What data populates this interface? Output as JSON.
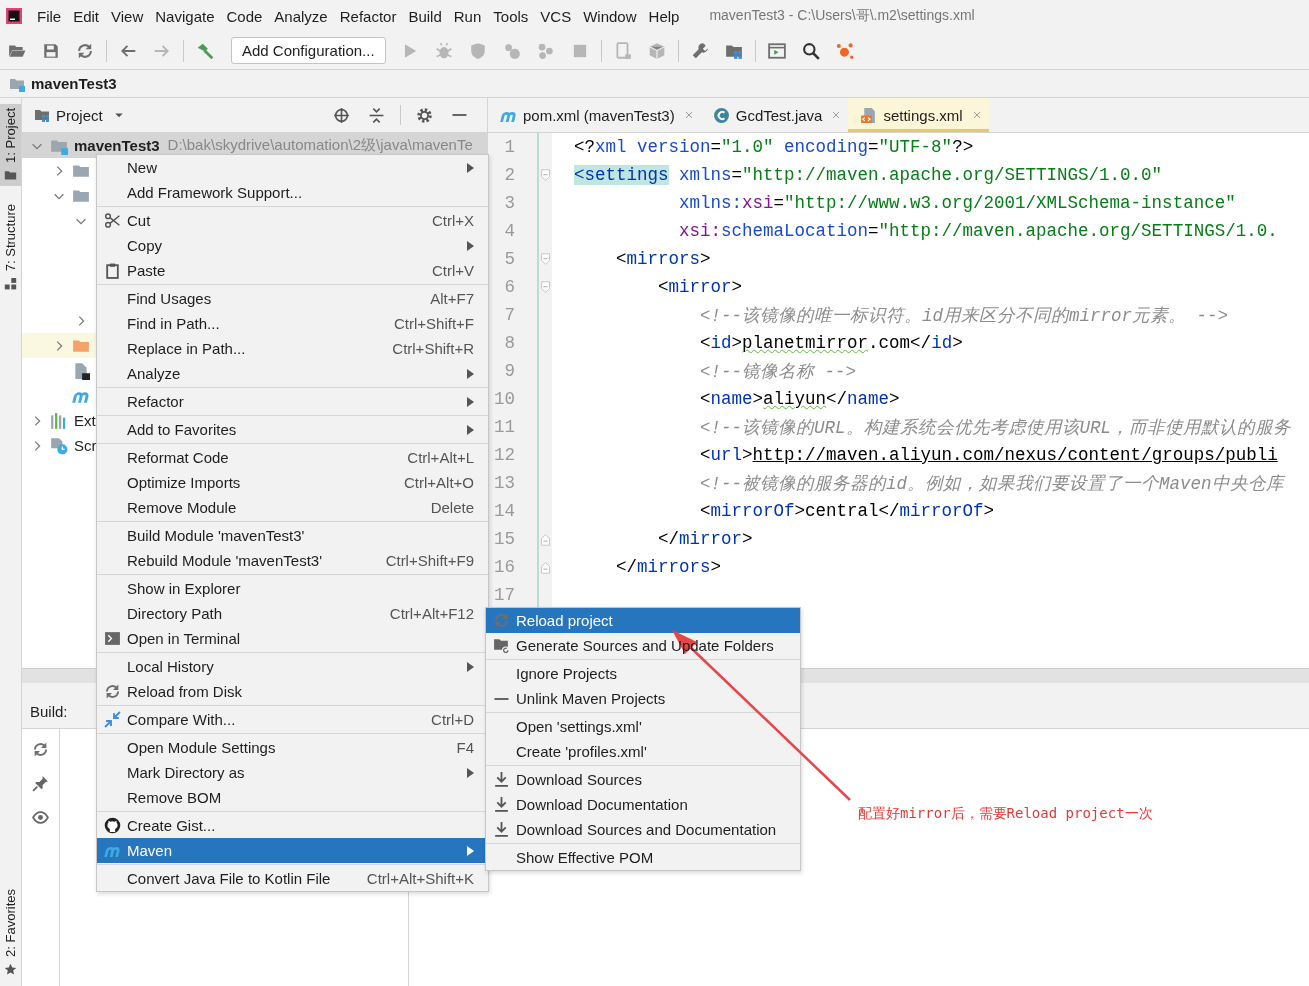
{
  "menubar": {
    "items": [
      {
        "label": "File"
      },
      {
        "label": "Edit"
      },
      {
        "label": "View"
      },
      {
        "label": "Navigate"
      },
      {
        "label": "Code"
      },
      {
        "label": "Analyze"
      },
      {
        "label": "Refactor"
      },
      {
        "label": "Build"
      },
      {
        "label": "Run"
      },
      {
        "label": "Tools"
      },
      {
        "label": "VCS"
      },
      {
        "label": "Window"
      },
      {
        "label": "Help"
      }
    ],
    "title": "mavenTest3 - C:\\Users\\哥\\.m2\\settings.xml"
  },
  "toolbar": [
    {
      "kind": "icon",
      "disabled": false
    },
    {
      "kind": "icon",
      "disabled": false
    },
    {
      "kind": "icon",
      "disabled": false
    },
    {
      "kind": "separator"
    },
    {
      "kind": "icon",
      "disabled": false
    },
    {
      "kind": "icon",
      "disabled": true
    },
    {
      "kind": "separator"
    },
    {
      "kind": "icon",
      "disabled": false
    },
    {
      "kind": "button",
      "label": "Add Configuration..."
    },
    {
      "kind": "icon",
      "disabled": true
    },
    {
      "kind": "icon",
      "disabled": true
    },
    {
      "kind": "icon",
      "disabled": true
    },
    {
      "kind": "icon",
      "disabled": true
    },
    {
      "kind": "icon",
      "disabled": true
    },
    {
      "kind": "icon",
      "disabled": true
    },
    {
      "kind": "separator"
    },
    {
      "kind": "icon",
      "disabled": true
    },
    {
      "kind": "icon",
      "disabled": true
    },
    {
      "kind": "separator"
    },
    {
      "kind": "icon",
      "disabled": false
    },
    {
      "kind": "icon",
      "disabled": false
    },
    {
      "kind": "separator"
    },
    {
      "kind": "icon",
      "disabled": false
    },
    {
      "kind": "icon",
      "disabled": false
    },
    {
      "kind": "icon",
      "disabled": false
    }
  ],
  "breadcrumb": {
    "label": "mavenTest3"
  },
  "left_stripe": [
    {
      "label": "1: Project",
      "selected": true
    },
    {
      "label": "7: Structure",
      "selected": false
    },
    {
      "label": "2: Favorites",
      "selected": false
    }
  ],
  "project_panel": {
    "title": "Project",
    "tree": [
      {
        "label": "mavenTest3",
        "detail": "D:\\bak\\skydrive\\automation\\2级\\java\\mavenTe",
        "expanded": true,
        "selected": true,
        "highlighted": false,
        "children": [
          {
            "expanded": false,
            "selected": false,
            "highlighted": false
          },
          {
            "expanded": true,
            "selected": false,
            "highlighted": false,
            "children": [
              {
                "expanded": true,
                "selected": false,
                "highlighted": false
              },
              {
                "expanded": false,
                "selected": false,
                "highlighted": false
              }
            ]
          },
          {
            "expanded": false,
            "selected": false,
            "highlighted": true
          },
          {
            "selected": false,
            "highlighted": false
          },
          {
            "selected": false,
            "highlighted": false
          }
        ]
      },
      {
        "label": "Ext",
        "expanded": false,
        "selected": false,
        "highlighted": false
      },
      {
        "label": "Scr",
        "expanded": false,
        "selected": false,
        "highlighted": false
      }
    ]
  },
  "editor_tabs": [
    {
      "label": "pom.xml (mavenTest3)",
      "selected": false
    },
    {
      "label": "GcdTest.java",
      "selected": false
    },
    {
      "label": "settings.xml",
      "selected": true
    }
  ],
  "editor_lines": [
    {
      "number": "1",
      "tokens": [
        {
          "kind": "punct",
          "text": "<?"
        },
        {
          "kind": "attr",
          "text": "xml version"
        },
        {
          "kind": "punct",
          "text": "="
        },
        {
          "kind": "value",
          "text": "\"1.0\""
        },
        {
          "kind": "attr",
          "text": " encoding"
        },
        {
          "kind": "punct",
          "text": "="
        },
        {
          "kind": "value",
          "text": "\"UTF-8\""
        },
        {
          "kind": "punct",
          "text": "?>"
        }
      ]
    },
    {
      "number": "2",
      "tokens": [
        {
          "kind": "matched",
          "text": "<settings"
        },
        {
          "kind": "attr",
          "text": " xmlns"
        },
        {
          "kind": "punct",
          "text": "="
        },
        {
          "kind": "value",
          "text": "\"http://maven.apache.org/SETTINGS/1.0.0\""
        }
      ]
    },
    {
      "number": "3",
      "tokens": [
        {
          "kind": "attr",
          "text": "          xmlns:"
        },
        {
          "kind": "ns",
          "text": "xsi"
        },
        {
          "kind": "punct",
          "text": "="
        },
        {
          "kind": "value",
          "text": "\"http://www.w3.org/2001/XMLSchema-instance\""
        }
      ]
    },
    {
      "number": "4",
      "tokens": [
        {
          "kind": "ns",
          "text": "          xsi:"
        },
        {
          "kind": "attr",
          "text": "schemaLocation"
        },
        {
          "kind": "punct",
          "text": "="
        },
        {
          "kind": "value",
          "text": "\"http://maven.apache.org/SETTINGS/1.0."
        }
      ]
    },
    {
      "number": "5",
      "tokens": [
        {
          "kind": "punct",
          "text": "    <"
        },
        {
          "kind": "tag",
          "text": "mirrors"
        },
        {
          "kind": "punct",
          "text": ">"
        }
      ]
    },
    {
      "number": "6",
      "tokens": [
        {
          "kind": "punct",
          "text": "        <"
        },
        {
          "kind": "tag",
          "text": "mirror"
        },
        {
          "kind": "punct",
          "text": ">"
        }
      ]
    },
    {
      "number": "7",
      "tokens": [
        {
          "kind": "comment",
          "text": "            <!--该镜像的唯一标识符。id用来区分不同的mirror元素。 -->"
        }
      ]
    },
    {
      "number": "8",
      "tokens": [
        {
          "kind": "punct",
          "text": "            <"
        },
        {
          "kind": "tag",
          "text": "id"
        },
        {
          "kind": "punct",
          "text": ">"
        },
        {
          "kind": "typo",
          "text": "planetmirror"
        },
        {
          "kind": "text",
          "text": ".com"
        },
        {
          "kind": "punct",
          "text": "</"
        },
        {
          "kind": "tag",
          "text": "id"
        },
        {
          "kind": "punct",
          "text": ">"
        }
      ]
    },
    {
      "number": "9",
      "tokens": [
        {
          "kind": "comment",
          "text": "            <!--镜像名称 -->"
        }
      ]
    },
    {
      "number": "10",
      "tokens": [
        {
          "kind": "punct",
          "text": "            <"
        },
        {
          "kind": "tag",
          "text": "name"
        },
        {
          "kind": "punct",
          "text": ">"
        },
        {
          "kind": "typo",
          "text": "aliyun"
        },
        {
          "kind": "punct",
          "text": "</"
        },
        {
          "kind": "tag",
          "text": "name"
        },
        {
          "kind": "punct",
          "text": ">"
        }
      ]
    },
    {
      "number": "11",
      "tokens": [
        {
          "kind": "comment",
          "text": "            <!--该镜像的URL。构建系统会优先考虑使用该URL，而非使用默认的服务"
        }
      ]
    },
    {
      "number": "12",
      "tokens": [
        {
          "kind": "punct",
          "text": "            <"
        },
        {
          "kind": "tag",
          "text": "url"
        },
        {
          "kind": "punct",
          "text": ">"
        },
        {
          "kind": "link",
          "text": "http://maven.aliyun.com/nexus/content/groups/publi"
        }
      ]
    },
    {
      "number": "13",
      "tokens": [
        {
          "kind": "comment",
          "text": "            <!--被镜像的服务器的id。例如，如果我们要设置了一个Maven中央仓库"
        }
      ]
    },
    {
      "number": "14",
      "tokens": [
        {
          "kind": "punct",
          "text": "            <"
        },
        {
          "kind": "tag",
          "text": "mirrorOf"
        },
        {
          "kind": "punct",
          "text": ">"
        },
        {
          "kind": "text",
          "text": "central"
        },
        {
          "kind": "punct",
          "text": "</"
        },
        {
          "kind": "tag",
          "text": "mirrorOf"
        },
        {
          "kind": "punct",
          "text": ">"
        }
      ]
    },
    {
      "number": "15",
      "tokens": [
        {
          "kind": "punct",
          "text": "        </"
        },
        {
          "kind": "tag",
          "text": "mirror"
        },
        {
          "kind": "punct",
          "text": ">"
        }
      ]
    },
    {
      "number": "16",
      "tokens": [
        {
          "kind": "punct",
          "text": "    </"
        },
        {
          "kind": "tag",
          "text": "mirrors"
        },
        {
          "kind": "punct",
          "text": ">"
        }
      ]
    },
    {
      "number": "17"
    }
  ],
  "build_panel": {
    "label": "Build:"
  },
  "context_menu": [
    {
      "label": "New",
      "submenu": true,
      "selected": false
    },
    {
      "label": "Add Framework Support...",
      "selected": false
    },
    {
      "label": "Cut",
      "shortcut": "Ctrl+X",
      "separator_before": true,
      "selected": false
    },
    {
      "label": "Copy",
      "submenu": true,
      "selected": false
    },
    {
      "label": "Paste",
      "shortcut": "Ctrl+V",
      "selected": false
    },
    {
      "label": "Find Usages",
      "shortcut": "Alt+F7",
      "separator_before": true,
      "selected": false
    },
    {
      "label": "Find in Path...",
      "shortcut": "Ctrl+Shift+F",
      "selected": false
    },
    {
      "label": "Replace in Path...",
      "shortcut": "Ctrl+Shift+R",
      "selected": false
    },
    {
      "label": "Analyze",
      "submenu": true,
      "selected": false
    },
    {
      "label": "Refactor",
      "submenu": true,
      "separator_before": true,
      "selected": false
    },
    {
      "label": "Add to Favorites",
      "submenu": true,
      "separator_before": true,
      "selected": false
    },
    {
      "label": "Reformat Code",
      "shortcut": "Ctrl+Alt+L",
      "separator_before": true,
      "selected": false
    },
    {
      "label": "Optimize Imports",
      "shortcut": "Ctrl+Alt+O",
      "selected": false
    },
    {
      "label": "Remove Module",
      "shortcut": "Delete",
      "selected": false
    },
    {
      "label": "Build Module 'mavenTest3'",
      "separator_before": true,
      "selected": false
    },
    {
      "label": "Rebuild Module 'mavenTest3'",
      "shortcut": "Ctrl+Shift+F9",
      "selected": false
    },
    {
      "label": "Show in Explorer",
      "separator_before": true,
      "selected": false
    },
    {
      "label": "Directory Path",
      "shortcut": "Ctrl+Alt+F12",
      "selected": false
    },
    {
      "label": "Open in Terminal",
      "selected": false
    },
    {
      "label": "Local History",
      "submenu": true,
      "separator_before": true,
      "selected": false
    },
    {
      "label": "Reload from Disk",
      "selected": false
    },
    {
      "label": "Compare With...",
      "shortcut": "Ctrl+D",
      "separator_before": true,
      "selected": false
    },
    {
      "label": "Open Module Settings",
      "shortcut": "F4",
      "separator_before": true,
      "selected": false
    },
    {
      "label": "Mark Directory as",
      "submenu": true,
      "selected": false
    },
    {
      "label": "Remove BOM",
      "selected": false
    },
    {
      "label": "Create Gist...",
      "separator_before": true,
      "selected": false
    },
    {
      "label": "Maven",
      "submenu": true,
      "selected": true
    },
    {
      "label": "Convert Java File to Kotlin File",
      "shortcut": "Ctrl+Alt+Shift+K",
      "separator_before": true,
      "selected": false
    }
  ],
  "maven_submenu": [
    {
      "label": "Reload project",
      "selected": true
    },
    {
      "label": "Generate Sources and Update Folders",
      "selected": false
    },
    {
      "label": "Ignore Projects",
      "separator_before": true,
      "selected": false
    },
    {
      "label": "Unlink Maven Projects",
      "selected": false
    },
    {
      "label": "Open 'settings.xml'",
      "separator_before": true,
      "selected": false
    },
    {
      "label": "Create 'profiles.xml'",
      "selected": false
    },
    {
      "label": "Download Sources",
      "separator_before": true,
      "selected": false
    },
    {
      "label": "Download Documentation",
      "selected": false
    },
    {
      "label": "Download Sources and Documentation",
      "selected": false
    },
    {
      "label": "Show Effective POM",
      "separator_before": true,
      "selected": false
    }
  ],
  "annotation": {
    "text": "配置好mirror后，需要Reload project一次"
  }
}
